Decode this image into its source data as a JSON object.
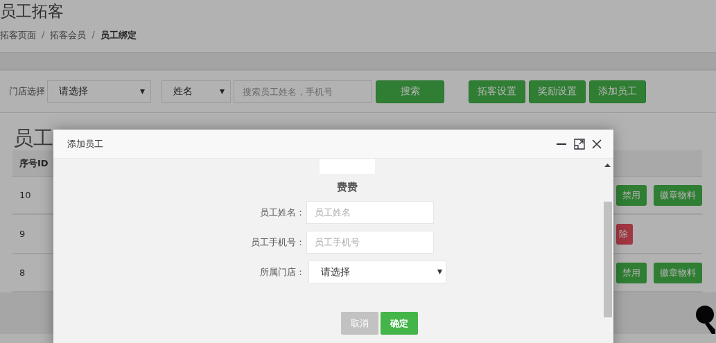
{
  "page": {
    "title": "员工拓客",
    "breadcrumb": [
      {
        "label": "拓客页面",
        "current": false
      },
      {
        "separator": "/",
        "label": "拓客会员",
        "current": false
      },
      {
        "separator": "/",
        "label": "员工绑定",
        "current": true
      }
    ]
  },
  "filters": {
    "store_label": "门店选择",
    "store_select": "请选择",
    "field_select": "姓名",
    "search": {
      "placeholder": "搜索员工姓名，手机号"
    },
    "search_button": "搜索",
    "actions": [
      "拓客设置",
      "奖励设置",
      "添加员工"
    ]
  },
  "section_title": "员工",
  "table": {
    "columns": [
      "序号ID"
    ],
    "rows": [
      {
        "id": "10",
        "actions": [
          {
            "label": "禁用",
            "kind": "primary"
          },
          {
            "label": "徽章物料",
            "kind": "primary"
          }
        ]
      },
      {
        "id": "9",
        "actions": [
          {
            "label": "除",
            "kind": "danger"
          }
        ]
      },
      {
        "id": "8",
        "actions": [
          {
            "label": "禁用",
            "kind": "primary"
          },
          {
            "label": "徽章物料",
            "kind": "primary"
          }
        ]
      }
    ]
  },
  "dialog": {
    "title": "添加员工",
    "heading": "费费",
    "fields": [
      {
        "kind": "input",
        "label": "员工姓名：",
        "placeholder": "员工姓名"
      },
      {
        "kind": "input",
        "label": "员工手机号：",
        "placeholder": "员工手机号"
      },
      {
        "kind": "select",
        "label": "所属门店：",
        "value": "请选择"
      }
    ],
    "buttons": [
      {
        "label": "取消",
        "kind": "cancel"
      },
      {
        "label": "确定",
        "kind": "confirm"
      }
    ]
  }
}
